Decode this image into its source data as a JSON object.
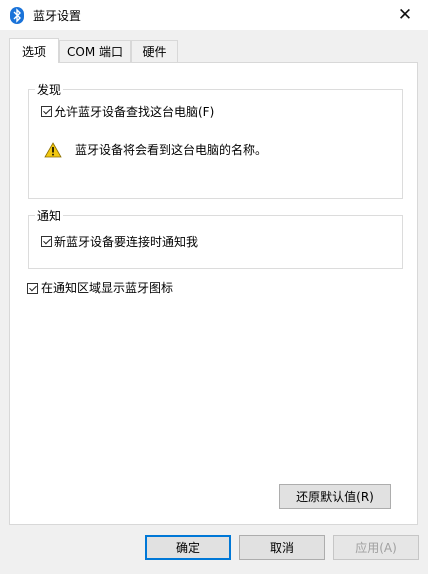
{
  "window": {
    "title": "蓝牙设置",
    "close_icon": "close-icon"
  },
  "tabs": [
    {
      "label": "选项",
      "active": true
    },
    {
      "label": "COM 端口",
      "active": false
    },
    {
      "label": "硬件",
      "active": false
    }
  ],
  "discovery": {
    "legend": "发现",
    "allow_label": "允许蓝牙设备查找这台电脑(F)",
    "allow_checked": true,
    "warning_text": "蓝牙设备将会看到这台电脑的名称。"
  },
  "notify": {
    "legend": "通知",
    "notify_label": "新蓝牙设备要连接时通知我",
    "notify_checked": true
  },
  "show_icon": {
    "label": "在通知区域显示蓝牙图标",
    "checked": true
  },
  "buttons": {
    "restore": "还原默认值(R)",
    "ok": "确定",
    "cancel": "取消",
    "apply": "应用(A)"
  },
  "colors": {
    "accent": "#0078d7",
    "bluetooth": "#1a73d9",
    "warning": "#f2c811"
  }
}
